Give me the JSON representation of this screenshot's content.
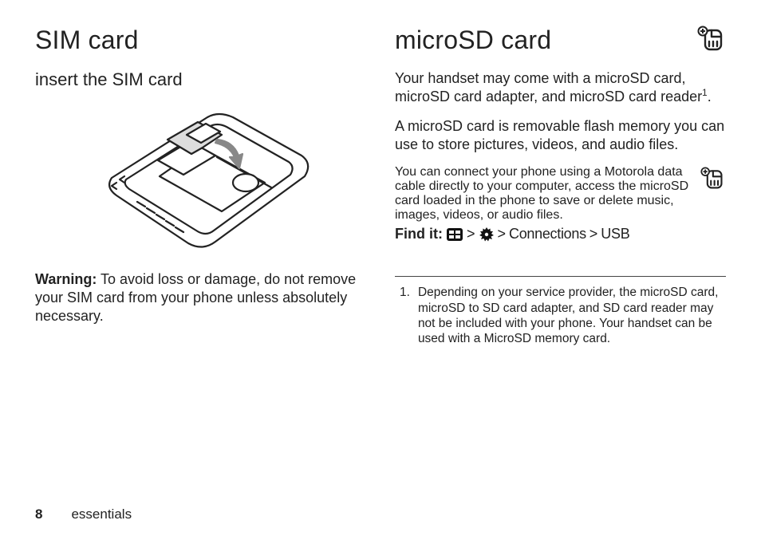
{
  "left": {
    "h1": "SIM card",
    "h2": "insert the SIM card",
    "warning_label": "Warning:",
    "warning_text": " To avoid loss or damage, do not remove your SIM card from your phone unless absolutely necessary."
  },
  "right": {
    "h1": "microSD card",
    "p1_a": "Your handset may come with a microSD card, microSD card adapter, and microSD card reader",
    "p1_sup": "1",
    "p1_b": ".",
    "p2": "A microSD card is removable flash memory you can use to store pictures, videos, and audio files.",
    "p3": "You can connect your phone using a Motorola data cable directly to your computer, access the microSD card loaded in the phone to save or delete music, images, videos, or audio files.",
    "findit_label": "Find it:",
    "findit_sep": ">",
    "findit_connections": "Connections",
    "findit_usb": "USB",
    "footnote_num": "1.",
    "footnote_text": "Depending on your service provider, the microSD card, microSD to SD card adapter, and SD card reader may not be included with your phone. Your handset can be used with a MicroSD memory card."
  },
  "footer": {
    "page": "8",
    "section": "essentials"
  }
}
